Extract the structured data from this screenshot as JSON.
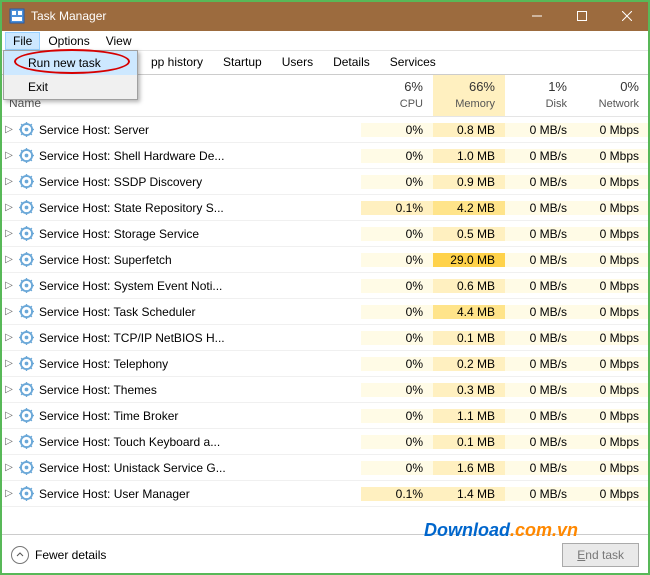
{
  "window": {
    "title": "Task Manager"
  },
  "menubar": {
    "file": "File",
    "options": "Options",
    "view": "View"
  },
  "dropdown": {
    "run_new_task": "Run new task",
    "exit": "Exit"
  },
  "tabs": {
    "app_history": "pp history",
    "startup": "Startup",
    "users": "Users",
    "details": "Details",
    "services": "Services"
  },
  "columns": {
    "name": "Name",
    "cpu": {
      "pct": "6%",
      "label": "CPU"
    },
    "memory": {
      "pct": "66%",
      "label": "Memory"
    },
    "disk": {
      "pct": "1%",
      "label": "Disk"
    },
    "network": {
      "pct": "0%",
      "label": "Network"
    }
  },
  "processes": [
    {
      "name": "Service Host: Server",
      "cpu": "0%",
      "mem": "0.8 MB",
      "disk": "0 MB/s",
      "net": "0 Mbps",
      "h": [
        "h0",
        "h1",
        "h0",
        "h0"
      ]
    },
    {
      "name": "Service Host: Shell Hardware De...",
      "cpu": "0%",
      "mem": "1.0 MB",
      "disk": "0 MB/s",
      "net": "0 Mbps",
      "h": [
        "h0",
        "h1",
        "h0",
        "h0"
      ]
    },
    {
      "name": "Service Host: SSDP Discovery",
      "cpu": "0%",
      "mem": "0.9 MB",
      "disk": "0 MB/s",
      "net": "0 Mbps",
      "h": [
        "h0",
        "h1",
        "h0",
        "h0"
      ]
    },
    {
      "name": "Service Host: State Repository S...",
      "cpu": "0.1%",
      "mem": "4.2 MB",
      "disk": "0 MB/s",
      "net": "0 Mbps",
      "h": [
        "h1",
        "h2",
        "h0",
        "h0"
      ]
    },
    {
      "name": "Service Host: Storage Service",
      "cpu": "0%",
      "mem": "0.5 MB",
      "disk": "0 MB/s",
      "net": "0 Mbps",
      "h": [
        "h0",
        "h1",
        "h0",
        "h0"
      ]
    },
    {
      "name": "Service Host: Superfetch",
      "cpu": "0%",
      "mem": "29.0 MB",
      "disk": "0 MB/s",
      "net": "0 Mbps",
      "h": [
        "h0",
        "h3",
        "h0",
        "h0"
      ]
    },
    {
      "name": "Service Host: System Event Noti...",
      "cpu": "0%",
      "mem": "0.6 MB",
      "disk": "0 MB/s",
      "net": "0 Mbps",
      "h": [
        "h0",
        "h1",
        "h0",
        "h0"
      ]
    },
    {
      "name": "Service Host: Task Scheduler",
      "cpu": "0%",
      "mem": "4.4 MB",
      "disk": "0 MB/s",
      "net": "0 Mbps",
      "h": [
        "h0",
        "h2",
        "h0",
        "h0"
      ]
    },
    {
      "name": "Service Host: TCP/IP NetBIOS H...",
      "cpu": "0%",
      "mem": "0.1 MB",
      "disk": "0 MB/s",
      "net": "0 Mbps",
      "h": [
        "h0",
        "h1",
        "h0",
        "h0"
      ]
    },
    {
      "name": "Service Host: Telephony",
      "cpu": "0%",
      "mem": "0.2 MB",
      "disk": "0 MB/s",
      "net": "0 Mbps",
      "h": [
        "h0",
        "h1",
        "h0",
        "h0"
      ]
    },
    {
      "name": "Service Host: Themes",
      "cpu": "0%",
      "mem": "0.3 MB",
      "disk": "0 MB/s",
      "net": "0 Mbps",
      "h": [
        "h0",
        "h1",
        "h0",
        "h0"
      ]
    },
    {
      "name": "Service Host: Time Broker",
      "cpu": "0%",
      "mem": "1.1 MB",
      "disk": "0 MB/s",
      "net": "0 Mbps",
      "h": [
        "h0",
        "h1",
        "h0",
        "h0"
      ]
    },
    {
      "name": "Service Host: Touch Keyboard a...",
      "cpu": "0%",
      "mem": "0.1 MB",
      "disk": "0 MB/s",
      "net": "0 Mbps",
      "h": [
        "h0",
        "h1",
        "h0",
        "h0"
      ]
    },
    {
      "name": "Service Host: Unistack Service G...",
      "cpu": "0%",
      "mem": "1.6 MB",
      "disk": "0 MB/s",
      "net": "0 Mbps",
      "h": [
        "h0",
        "h1",
        "h0",
        "h0"
      ]
    },
    {
      "name": "Service Host: User Manager",
      "cpu": "0.1%",
      "mem": "1.4 MB",
      "disk": "0 MB/s",
      "net": "0 Mbps",
      "h": [
        "h1",
        "h1",
        "h0",
        "h0"
      ]
    }
  ],
  "footer": {
    "fewer_details": "Fewer details",
    "end_task": "End task"
  },
  "watermark": {
    "part1": "Download",
    "part2": ".com.vn"
  }
}
